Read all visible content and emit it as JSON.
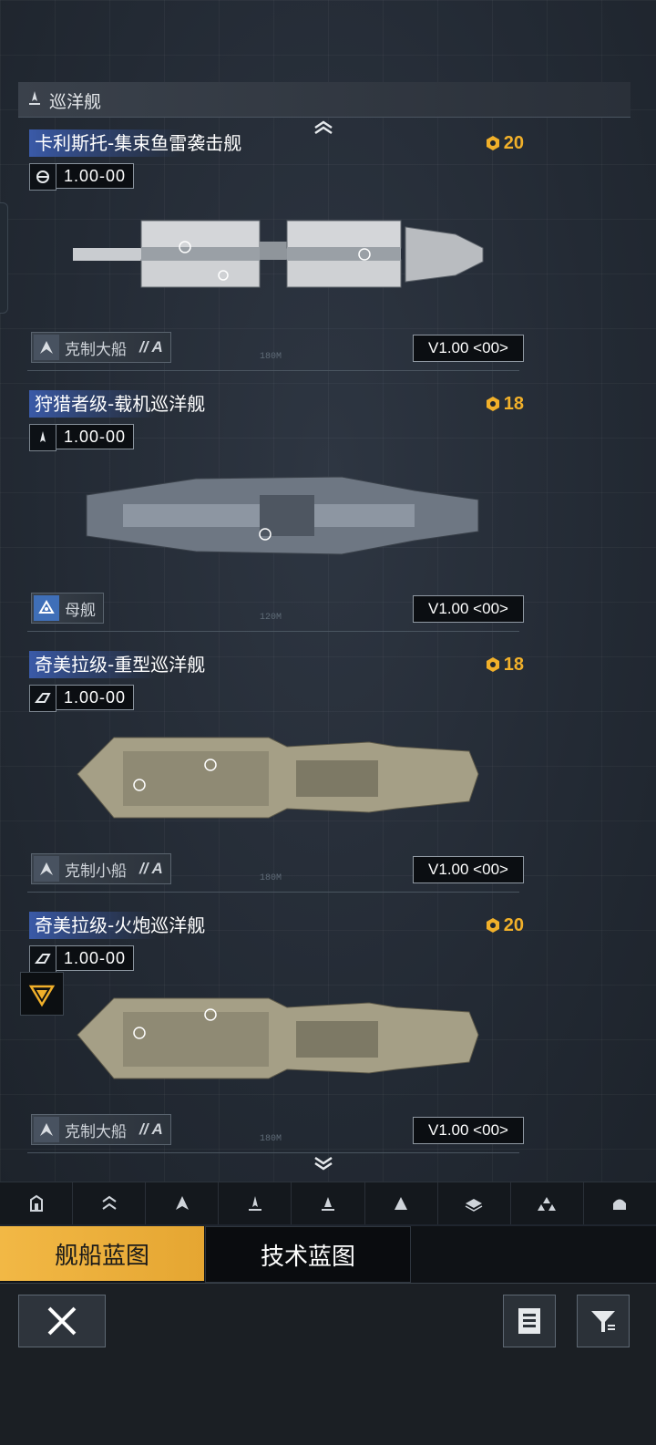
{
  "section": {
    "title": "巡洋舰",
    "icon": "cruiser-class-icon"
  },
  "ships": [
    {
      "name": "卡利斯托-集束鱼雷袭击舰",
      "cost": "20",
      "level": "1.00-00",
      "level_icon": "torpedo-icon",
      "tag_icon": "counter-icon",
      "tag": "克制大船",
      "tag_suffix": "// A",
      "version": "V1.00 <00>",
      "rule_label": "180M",
      "hull_color": "#c9ccd0"
    },
    {
      "name": "狩猎者级-载机巡洋舰",
      "cost": "18",
      "level": "1.00-00",
      "level_icon": "carrier-icon",
      "tag_icon": "mothership-icon",
      "tag": "母舰",
      "tag_suffix": "",
      "version": "V1.00 <00>",
      "rule_label": "120M",
      "hull_color": "#7f8894"
    },
    {
      "name": "奇美拉级-重型巡洋舰",
      "cost": "18",
      "level": "1.00-00",
      "level_icon": "heavy-icon",
      "tag_icon": "counter-icon",
      "tag": "克制小船",
      "tag_suffix": "// A",
      "version": "V1.00 <00>",
      "rule_label": "180M",
      "hull_color": "#a59f86"
    },
    {
      "name": "奇美拉级-火炮巡洋舰",
      "cost": "20",
      "level": "1.00-00",
      "level_icon": "heavy-icon",
      "tag_icon": "counter-icon",
      "tag": "克制大船",
      "tag_suffix": "// A",
      "version": "V1.00 <00>",
      "rule_label": "180M",
      "hull_color": "#a59f86"
    }
  ],
  "category_bar": [
    "frigate-icon",
    "destroyer-icon",
    "corvette-icon",
    "cruiser-icon",
    "battlecruiser-icon",
    "battleship-icon",
    "carrier-icon",
    "auxiliary-icon",
    "special-icon"
  ],
  "tabs": {
    "active": "舰船蓝图",
    "inactive": "技术蓝图"
  },
  "colors": {
    "accent": "#f1b02a",
    "name_bg": "#3a5aa8"
  }
}
